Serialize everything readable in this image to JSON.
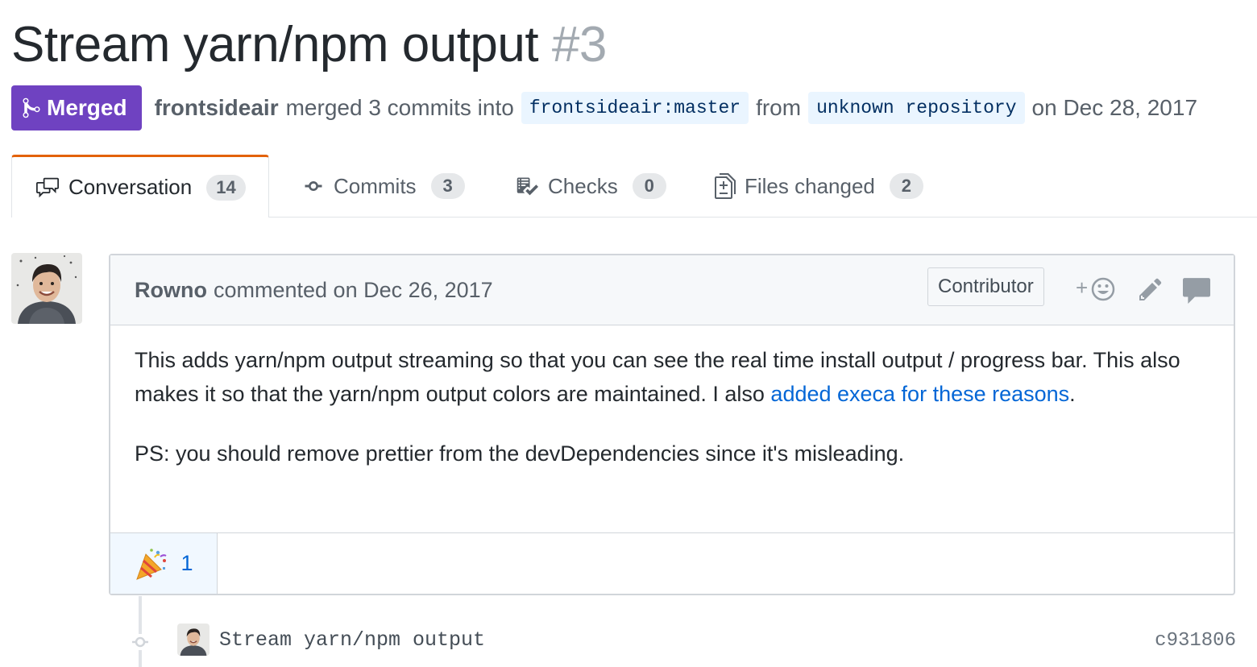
{
  "pr": {
    "title": "Stream yarn/npm output",
    "number": "#3",
    "state_label": "Merged",
    "author": "frontsideair",
    "merged_text": "merged 3 commits into",
    "base_branch": "frontsideair:master",
    "from_text": "from",
    "head_branch": "unknown repository",
    "date_text": "on Dec 28, 2017"
  },
  "tabs": [
    {
      "label": "Conversation",
      "count": "14",
      "icon": "comment-discussion-icon",
      "selected": true
    },
    {
      "label": "Commits",
      "count": "3",
      "icon": "git-commit-icon",
      "selected": false
    },
    {
      "label": "Checks",
      "count": "0",
      "icon": "checklist-icon",
      "selected": false
    },
    {
      "label": "Files changed",
      "count": "2",
      "icon": "diff-icon",
      "selected": false
    }
  ],
  "comment": {
    "author": "Rowno",
    "action_text": "commented on Dec 26, 2017",
    "role_badge": "Contributor",
    "body_p1_text": "This adds yarn/npm output streaming so that you can see the real time install output / progress bar. This also makes it so that the yarn/npm output colors are maintained. I also ",
    "body_p1_link": "added execa for these reasons",
    "body_p1_end": ".",
    "body_p2": "PS: you should remove prettier from the devDependencies since it's misleading.",
    "reaction_emoji": "🎉",
    "reaction_count": "1"
  },
  "commit": {
    "message": "Stream yarn/npm output",
    "sha": "c931806"
  },
  "colors": {
    "merged": "#6f42c1",
    "link": "#0366d6",
    "tab_accent": "#e36209"
  }
}
